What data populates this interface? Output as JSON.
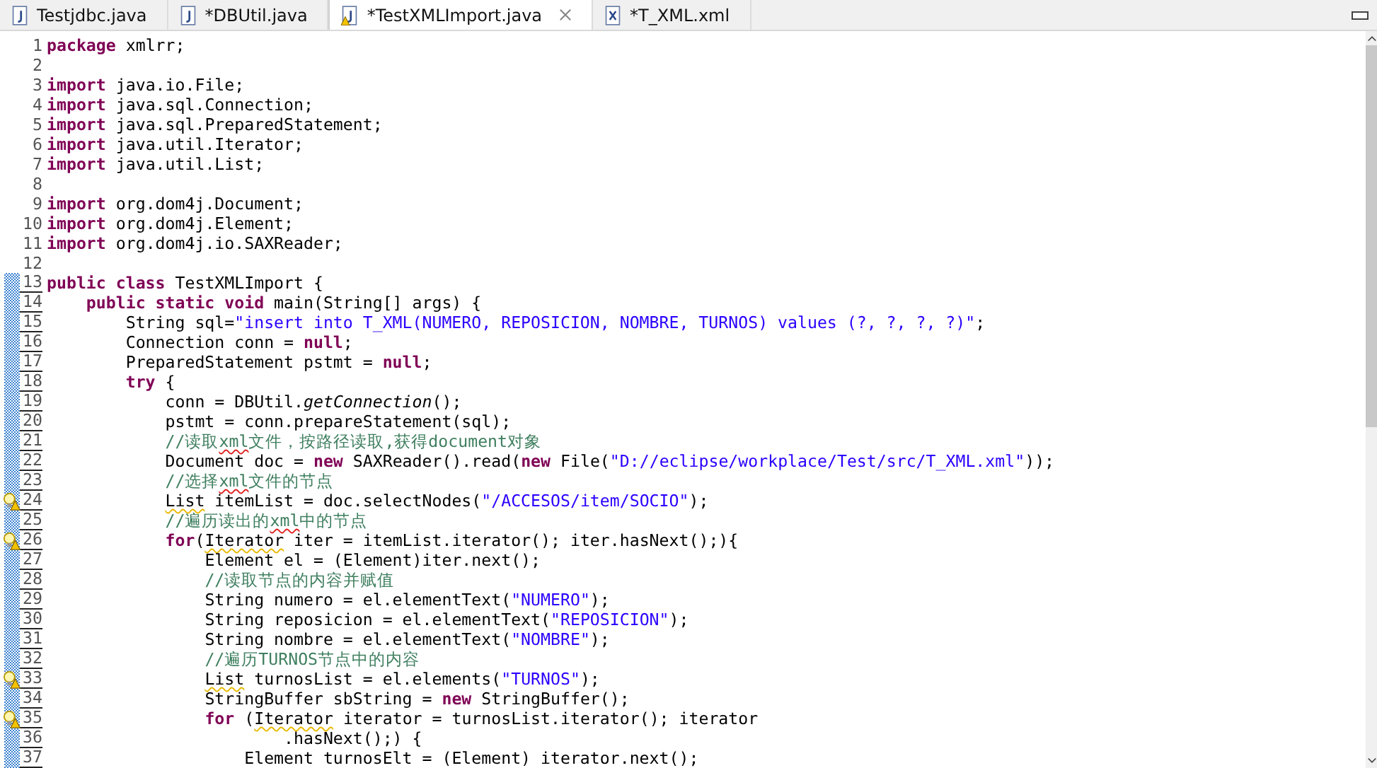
{
  "tabs": [
    {
      "label": "Testjdbc.java",
      "kind": "java",
      "warning": false,
      "selected": false,
      "closable": false
    },
    {
      "label": "*DBUtil.java",
      "kind": "java",
      "warning": false,
      "selected": false,
      "closable": false
    },
    {
      "label": "*TestXMLImport.java",
      "kind": "java",
      "warning": true,
      "selected": true,
      "closable": true
    },
    {
      "label": "*T_XML.xml",
      "kind": "xml",
      "warning": false,
      "selected": false,
      "closable": false
    }
  ],
  "editor": {
    "lines": [
      {
        "number": "1",
        "changed": false,
        "warning": false,
        "tokens": [
          {
            "kind": "kw",
            "text": "package"
          },
          {
            "kind": "plain",
            "text": " xmlrr;"
          }
        ]
      },
      {
        "number": "2",
        "changed": false,
        "warning": false
      },
      {
        "number": "3",
        "changed": false,
        "warning": false,
        "tokens": [
          {
            "kind": "kw",
            "text": "import"
          },
          {
            "kind": "plain",
            "text": " java.io.File;"
          }
        ]
      },
      {
        "number": "4",
        "changed": false,
        "warning": false,
        "tokens": [
          {
            "kind": "kw",
            "text": "import"
          },
          {
            "kind": "plain",
            "text": " java.sql.Connection;"
          }
        ]
      },
      {
        "number": "5",
        "changed": false,
        "warning": false,
        "tokens": [
          {
            "kind": "kw",
            "text": "import"
          },
          {
            "kind": "plain",
            "text": " java.sql.PreparedStatement;"
          }
        ]
      },
      {
        "number": "6",
        "changed": false,
        "warning": false,
        "tokens": [
          {
            "kind": "kw",
            "text": "import"
          },
          {
            "kind": "plain",
            "text": " java.util.Iterator;"
          }
        ]
      },
      {
        "number": "7",
        "changed": false,
        "warning": false,
        "tokens": [
          {
            "kind": "kw",
            "text": "import"
          },
          {
            "kind": "plain",
            "text": " java.util.List;"
          }
        ]
      },
      {
        "number": "8",
        "changed": false,
        "warning": false
      },
      {
        "number": "9",
        "changed": false,
        "warning": false,
        "tokens": [
          {
            "kind": "kw",
            "text": "import"
          },
          {
            "kind": "plain",
            "text": " org.dom4j.Document;"
          }
        ]
      },
      {
        "number": "10",
        "changed": false,
        "warning": false,
        "tokens": [
          {
            "kind": "kw",
            "text": "import"
          },
          {
            "kind": "plain",
            "text": " org.dom4j.Element;"
          }
        ]
      },
      {
        "number": "11",
        "changed": false,
        "warning": false,
        "tokens": [
          {
            "kind": "kw",
            "text": "import"
          },
          {
            "kind": "plain",
            "text": " org.dom4j.io.SAXReader;"
          }
        ]
      },
      {
        "number": "12",
        "changed": false,
        "warning": false
      },
      {
        "number": "13",
        "changed": true,
        "warning": false,
        "tokens": [
          {
            "kind": "kw",
            "text": "public class"
          },
          {
            "kind": "plain",
            "text": " TestXMLImport {"
          }
        ]
      },
      {
        "number": "14",
        "changed": true,
        "warning": false,
        "tokens": [
          {
            "kind": "kw",
            "text": "    public static void"
          },
          {
            "kind": "plain",
            "text": " main(String[] args) {"
          }
        ]
      },
      {
        "number": "15",
        "changed": true,
        "warning": false,
        "tokens": [
          {
            "kind": "plain",
            "text": "        String sql="
          },
          {
            "kind": "str",
            "text": "\"insert into T_XML(NUMERO, REPOSICION, NOMBRE, TURNOS) values (?, ?, ?, ?)\""
          },
          {
            "kind": "plain",
            "text": ";"
          }
        ]
      },
      {
        "number": "16",
        "changed": true,
        "warning": false,
        "tokens": [
          {
            "kind": "plain",
            "text": "        Connection conn = "
          },
          {
            "kind": "kw",
            "text": "null"
          },
          {
            "kind": "plain",
            "text": ";"
          }
        ]
      },
      {
        "number": "17",
        "changed": true,
        "warning": false,
        "tokens": [
          {
            "kind": "plain",
            "text": "        PreparedStatement pstmt = "
          },
          {
            "kind": "kw",
            "text": "null"
          },
          {
            "kind": "plain",
            "text": ";"
          }
        ]
      },
      {
        "number": "18",
        "changed": true,
        "warning": false,
        "tokens": [
          {
            "kind": "kw",
            "text": "        try"
          },
          {
            "kind": "plain",
            "text": " {"
          }
        ]
      },
      {
        "number": "19",
        "changed": true,
        "warning": false,
        "tokens": [
          {
            "kind": "plain",
            "text": "            conn = DBUtil."
          },
          {
            "kind": "static",
            "text": "getConnection"
          },
          {
            "kind": "plain",
            "text": "();"
          }
        ]
      },
      {
        "number": "20",
        "changed": true,
        "warning": false,
        "tokens": [
          {
            "kind": "plain",
            "text": "            pstmt = conn.prepareStatement(sql);"
          }
        ]
      },
      {
        "number": "21",
        "changed": true,
        "warning": false,
        "tokens": [
          {
            "kind": "comment",
            "text": "            //读取"
          },
          {
            "kind": "misspelled",
            "text": "xml"
          },
          {
            "kind": "comment",
            "text": "文件，按路径读取,获得document对象"
          }
        ]
      },
      {
        "number": "22",
        "changed": true,
        "warning": false,
        "tokens": [
          {
            "kind": "plain",
            "text": "            Document doc = "
          },
          {
            "kind": "kw",
            "text": "new"
          },
          {
            "kind": "plain",
            "text": " SAXReader().read("
          },
          {
            "kind": "kw",
            "text": "new"
          },
          {
            "kind": "plain",
            "text": " File("
          },
          {
            "kind": "str",
            "text": "\"D://eclipse/workplace/Test/src/T_XML.xml\""
          },
          {
            "kind": "plain",
            "text": "));"
          }
        ]
      },
      {
        "number": "23",
        "changed": true,
        "warning": false,
        "tokens": [
          {
            "kind": "comment",
            "text": "            //选择"
          },
          {
            "kind": "misspelled",
            "text": "xml"
          },
          {
            "kind": "comment",
            "text": "文件的节点"
          }
        ]
      },
      {
        "number": "24",
        "changed": true,
        "warning": true,
        "tokens": [
          {
            "kind": "flagged",
            "text": "            List"
          },
          {
            "kind": "plain",
            "text": " itemList = doc.selectNodes("
          },
          {
            "kind": "str",
            "text": "\"/ACCESOS/item/SOCIO\""
          },
          {
            "kind": "plain",
            "text": ");"
          }
        ]
      },
      {
        "number": "25",
        "changed": true,
        "warning": false,
        "tokens": [
          {
            "kind": "comment",
            "text": "            //遍历读出的"
          },
          {
            "kind": "misspelled",
            "text": "xml"
          },
          {
            "kind": "comment",
            "text": "中的节点"
          }
        ]
      },
      {
        "number": "26",
        "changed": true,
        "warning": true,
        "tokens": [
          {
            "kind": "kw",
            "text": "            for"
          },
          {
            "kind": "plain",
            "text": "("
          },
          {
            "kind": "flagged",
            "text": "Iterator"
          },
          {
            "kind": "plain",
            "text": " iter = itemList.iterator(); iter.hasNext();){"
          }
        ]
      },
      {
        "number": "27",
        "changed": true,
        "warning": false,
        "tokens": [
          {
            "kind": "plain",
            "text": "                Element el = (Element)iter.next();"
          }
        ]
      },
      {
        "number": "28",
        "changed": true,
        "warning": false,
        "tokens": [
          {
            "kind": "comment",
            "text": "                //读取节点的内容并赋值"
          }
        ]
      },
      {
        "number": "29",
        "changed": true,
        "warning": false,
        "tokens": [
          {
            "kind": "plain",
            "text": "                String numero = el.elementText("
          },
          {
            "kind": "str",
            "text": "\"NUMERO\""
          },
          {
            "kind": "plain",
            "text": ");"
          }
        ]
      },
      {
        "number": "30",
        "changed": true,
        "warning": false,
        "tokens": [
          {
            "kind": "plain",
            "text": "                String reposicion = el.elementText("
          },
          {
            "kind": "str",
            "text": "\"REPOSICION\""
          },
          {
            "kind": "plain",
            "text": ");"
          }
        ]
      },
      {
        "number": "31",
        "changed": true,
        "warning": false,
        "tokens": [
          {
            "kind": "plain",
            "text": "                String nombre = el.elementText("
          },
          {
            "kind": "str",
            "text": "\"NOMBRE\""
          },
          {
            "kind": "plain",
            "text": ");"
          }
        ]
      },
      {
        "number": "32",
        "changed": true,
        "warning": false,
        "tokens": [
          {
            "kind": "comment",
            "text": "                //遍历TURNOS节点中的内容"
          }
        ]
      },
      {
        "number": "33",
        "changed": true,
        "warning": true,
        "tokens": [
          {
            "kind": "flagged",
            "text": "                List"
          },
          {
            "kind": "plain",
            "text": " turnosList = el.elements("
          },
          {
            "kind": "str",
            "text": "\"TURNOS\""
          },
          {
            "kind": "plain",
            "text": ");"
          }
        ]
      },
      {
        "number": "34",
        "changed": true,
        "warning": false,
        "tokens": [
          {
            "kind": "plain",
            "text": "                StringBuffer sbString = "
          },
          {
            "kind": "kw",
            "text": "new"
          },
          {
            "kind": "plain",
            "text": " StringBuffer();"
          }
        ]
      },
      {
        "number": "35",
        "changed": true,
        "warning": true,
        "tokens": [
          {
            "kind": "kw",
            "text": "                for"
          },
          {
            "kind": "plain",
            "text": " ("
          },
          {
            "kind": "flagged",
            "text": "Iterator"
          },
          {
            "kind": "plain",
            "text": " iterator = turnosList.iterator(); iterator"
          }
        ]
      },
      {
        "number": "36",
        "changed": true,
        "warning": false,
        "tokens": [
          {
            "kind": "plain",
            "text": "                        .hasNext();) {"
          }
        ]
      },
      {
        "number": "37",
        "changed": true,
        "warning": false,
        "tokens": [
          {
            "kind": "plain",
            "text": "                    Element turnosElt = (Element) iterator.next();"
          }
        ]
      }
    ]
  }
}
